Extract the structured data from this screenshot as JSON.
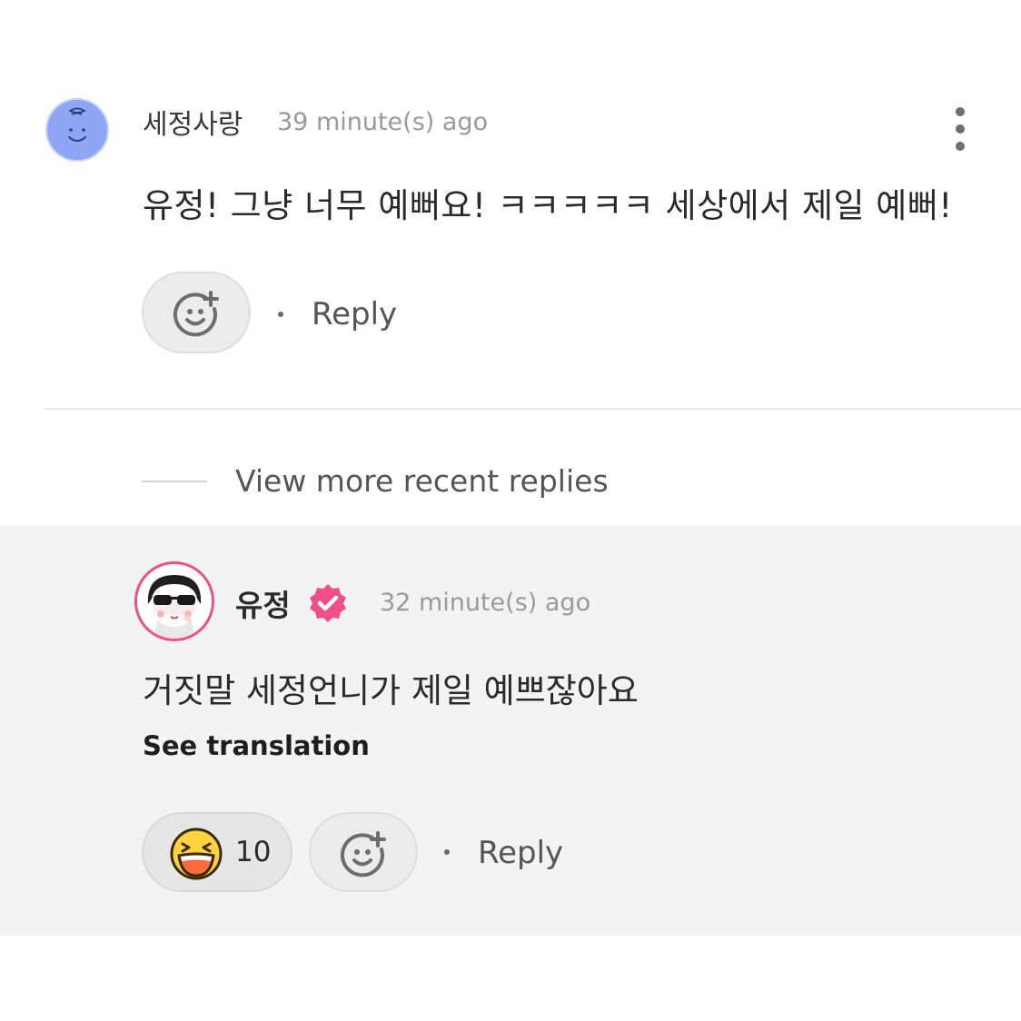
{
  "comment": {
    "username": "세정사랑",
    "timestamp": "39 minute(s) ago",
    "body": "유정! 그냥 너무 예뻐요! ㅋㅋㅋㅋㅋ 세상에서 제일 예뻐!",
    "reply_label": "Reply",
    "avatar_icon": "smiley-face-avatar",
    "avatar_color": "#8fa6f5"
  },
  "view_more": {
    "label": "View more recent replies"
  },
  "reply": {
    "username": "유정",
    "verified": true,
    "verified_color": "#ef4f86",
    "timestamp": "32 minute(s) ago",
    "body": "거짓말 세정언니가 제일 예쁘잖아요",
    "see_translation_label": "See translation",
    "reaction_icon": "laughing-face-emoji",
    "reaction_count": "10",
    "reply_label": "Reply"
  }
}
